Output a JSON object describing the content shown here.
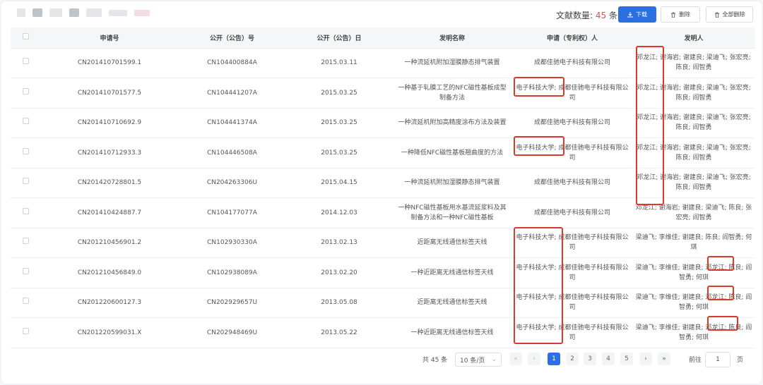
{
  "toolbar": {
    "count_label": "文献数量:",
    "count_value": "45",
    "count_unit": "条",
    "download_label": "下载",
    "delete_label": "删除",
    "delete_all_label": "全部删除"
  },
  "table": {
    "columns": [
      "申请号",
      "公开（公告）号",
      "公开（公告）日",
      "发明名称",
      "申请（专利权）人",
      "发明人"
    ],
    "rows": [
      {
        "app_no": "CN201410701599.1",
        "pub_no": "CN104400884A",
        "pub_date": "2015.03.11",
        "title": "一种流延机附加湿膜静态排气装置",
        "applicant": "成都佳驰电子科技有限公司",
        "inventor": "邓龙江; 谢海岩; 谢建良; 梁迪飞; 张宏亮; 陈良; 阎智勇"
      },
      {
        "app_no": "CN201410701577.5",
        "pub_no": "CN104441207A",
        "pub_date": "2015.03.25",
        "title": "一种基于轧膜工艺的NFC磁性基板成型制备方法",
        "applicant": "电子科技大学; 成都佳驰电子科技有限公司",
        "inventor": "邓龙江; 谢海岩; 谢建良; 梁迪飞; 张宏亮; 陈良; 阎智勇"
      },
      {
        "app_no": "CN201410710692.9",
        "pub_no": "CN104441374A",
        "pub_date": "2015.03.25",
        "title": "一种流延机附加高精度涂布方法及装置",
        "applicant": "成都佳驰电子科技有限公司",
        "inventor": "邓龙江; 谢海岩; 谢建良; 梁迪飞; 张宏亮; 陈良; 阎智勇"
      },
      {
        "app_no": "CN201410712933.3",
        "pub_no": "CN104446508A",
        "pub_date": "2015.03.25",
        "title": "一种降低NFC磁性基板翘曲度的方法",
        "applicant": "电子科技大学; 成都佳驰电子科技有限公司",
        "inventor": "邓龙江; 谢海岩; 谢建良; 梁迪飞; 张宏亮; 陈良; 阎智勇"
      },
      {
        "app_no": "CN201420728801.5",
        "pub_no": "CN204263306U",
        "pub_date": "2015.04.15",
        "title": "一种流延机附加湿膜静态排气装置",
        "applicant": "成都佳驰电子科技有限公司",
        "inventor": "邓龙江; 谢海岩; 谢建良; 梁迪飞; 张宏亮; 陈良; 阎智勇"
      },
      {
        "app_no": "CN201410424887.7",
        "pub_no": "CN104177077A",
        "pub_date": "2014.12.03",
        "title": "一种NFC磁性基板用水基流延浆料及其制备方法和一种NFC磁性基板",
        "applicant": "成都佳驰电子科技有限公司",
        "inventor": "邓龙江; 谢海岩; 谢建良; 梁迪飞; 陈良; 张宏亮; 阎智勇"
      },
      {
        "app_no": "CN201210456901.2",
        "pub_no": "CN102930330A",
        "pub_date": "2013.02.13",
        "title": "近距离无线通信标签天线",
        "applicant": "电子科技大学; 成都佳驰电子科技有限公司",
        "inventor": "梁迪飞; 李维佳; 谢建良; 陈良; 阎智勇; 何琪"
      },
      {
        "app_no": "CN201210456849.0",
        "pub_no": "CN102938089A",
        "pub_date": "2013.02.20",
        "title": "一种近距离无线通信标签天线",
        "applicant": "电子科技大学; 成都佳驰电子科技有限公司",
        "inventor": "梁迪飞; 李维佳; 谢建良; 邓龙江; 陈良; 阎智勇; 何琪"
      },
      {
        "app_no": "CN201220600127.3",
        "pub_no": "CN202929657U",
        "pub_date": "2013.05.08",
        "title": "近距离无线通信标签天线",
        "applicant": "电子科技大学; 成都佳驰电子科技有限公司",
        "inventor": "梁迪飞; 李维佳; 谢建良; 邓龙江; 陈良; 阎智勇; 何琪"
      },
      {
        "app_no": "CN201220599031.X",
        "pub_no": "CN202948469U",
        "pub_date": "2013.05.22",
        "title": "一种近距离无线通信标签天线",
        "applicant": "电子科技大学; 成都佳驰电子科技有限公司",
        "inventor": "梁迪飞; 李维佳; 谢建良; 邓龙江; 陈良; 阎智勇; 何琪"
      }
    ]
  },
  "pagination": {
    "total_label": "共 45 条",
    "page_size": "10 条/页",
    "pages": [
      "1",
      "2",
      "3",
      "4",
      "5"
    ],
    "goto_label": "前往",
    "goto_value": "1",
    "page_unit": "页"
  },
  "colors": {
    "accent": "#2b6fe0",
    "count": "#e24f4f",
    "highlight": "#d83a2c"
  }
}
